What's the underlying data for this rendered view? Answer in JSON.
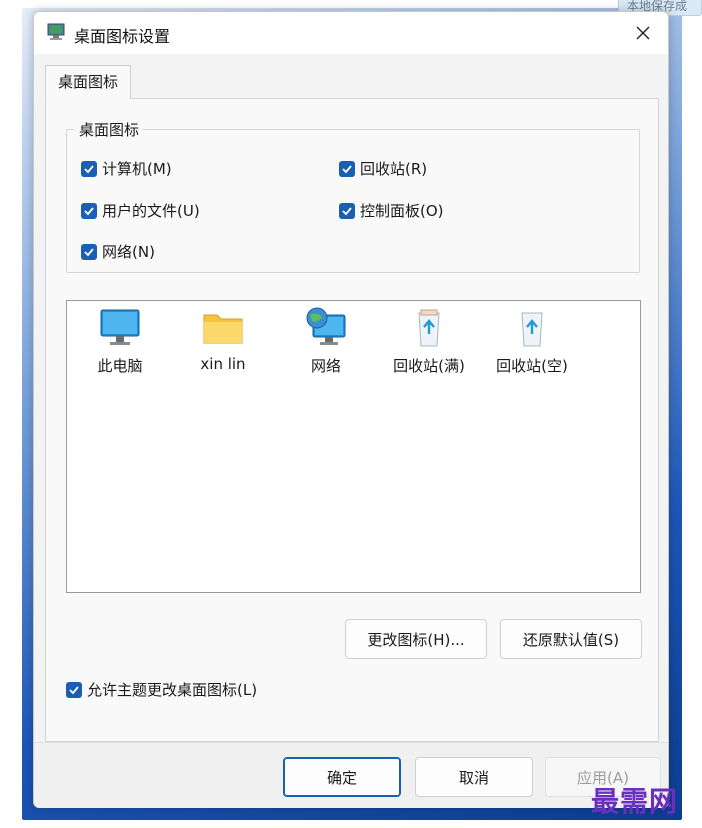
{
  "corner_note": "本地保存成",
  "window": {
    "title": "桌面图标设置"
  },
  "tab": {
    "label": "桌面图标"
  },
  "group": {
    "legend": "桌面图标",
    "checkboxes": [
      {
        "label": "计算机(M)",
        "checked": true
      },
      {
        "label": "回收站(R)",
        "checked": true
      },
      {
        "label": "用户的文件(U)",
        "checked": true
      },
      {
        "label": "控制面板(O)",
        "checked": true
      },
      {
        "label": "网络(N)",
        "checked": true
      }
    ]
  },
  "icons": [
    {
      "label": "此电脑",
      "icon": "monitor-icon"
    },
    {
      "label": "xin lin",
      "icon": "folder-icon"
    },
    {
      "label": "网络",
      "icon": "network-globe-icon"
    },
    {
      "label": "回收站(满)",
      "icon": "recycle-bin-full-icon"
    },
    {
      "label": "回收站(空)",
      "icon": "recycle-bin-empty-icon"
    }
  ],
  "buttons": {
    "change_icon": "更改图标(H)...",
    "restore_default": "还原默认值(S)",
    "ok": "确定",
    "cancel": "取消",
    "apply": "应用(A)"
  },
  "allow_themes": {
    "label": "允许主题更改桌面图标(L)",
    "checked": true
  },
  "watermark": "最需网",
  "colors": {
    "accent": "#1a5fb4",
    "watermark": "#6a2fbf"
  }
}
